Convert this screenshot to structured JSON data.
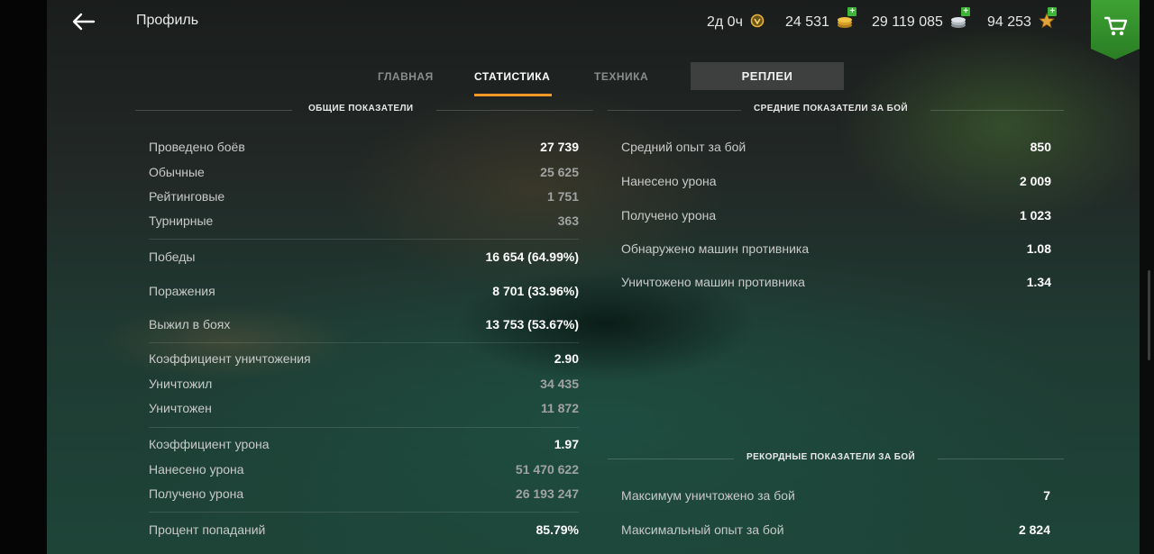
{
  "header": {
    "title": "Профиль",
    "premium_time": "2д 0ч",
    "gold": "24 531",
    "credits": "29 119 085",
    "free_xp": "94 253"
  },
  "tabs": {
    "main": "ГЛАВНАЯ",
    "stats": "СТАТИСТИКА",
    "vehicles": "ТЕХНИКА",
    "replays": "РЕПЛЕИ"
  },
  "general": {
    "heading": "ОБЩИЕ ПОКАЗАТЕЛИ",
    "battles": {
      "label": "Проведено боёв",
      "value": "27 739"
    },
    "regular": {
      "label": "Обычные",
      "value": "25 625"
    },
    "rated": {
      "label": "Рейтинговые",
      "value": "1 751"
    },
    "tournament": {
      "label": "Турнирные",
      "value": "363"
    },
    "wins": {
      "label": "Победы",
      "value": "16 654 (64.99%)"
    },
    "losses": {
      "label": "Поражения",
      "value": "8 701 (33.96%)"
    },
    "survived": {
      "label": "Выжил в боях",
      "value": "13 753 (53.67%)"
    },
    "kill_ratio": {
      "label": "Коэффициент уничтожения",
      "value": "2.90"
    },
    "destroyed": {
      "label": "Уничтожил",
      "value": "34 435"
    },
    "was_destroyed": {
      "label": "Уничтожен",
      "value": "11 872"
    },
    "damage_ratio": {
      "label": "Коэффициент урона",
      "value": "1.97"
    },
    "damage_dealt": {
      "label": "Нанесено урона",
      "value": "51 470 622"
    },
    "damage_received": {
      "label": "Получено урона",
      "value": "26 193 247"
    },
    "hit_rate": {
      "label": "Процент попаданий",
      "value": "85.79%"
    }
  },
  "average": {
    "heading": "СРЕДНИЕ ПОКАЗАТЕЛИ ЗА БОЙ",
    "xp": {
      "label": "Средний опыт за бой",
      "value": "850"
    },
    "damage_dealt": {
      "label": "Нанесено урона",
      "value": "2 009"
    },
    "damage_received": {
      "label": "Получено урона",
      "value": "1 023"
    },
    "spotted": {
      "label": "Обнаружено машин противника",
      "value": "1.08"
    },
    "destroyed": {
      "label": "Уничтожено машин противника",
      "value": "1.34"
    }
  },
  "records": {
    "heading": "РЕКОРДНЫЕ ПОКАЗАТЕЛИ ЗА БОЙ",
    "max_kills": {
      "label": "Максимум уничтожено за бой",
      "value": "7"
    },
    "max_xp": {
      "label": "Максимальный опыт за бой",
      "value": "2 824"
    }
  },
  "colors": {
    "accent": "#f3992a",
    "shop": "#3ea234",
    "gold": "#e8b23a"
  }
}
